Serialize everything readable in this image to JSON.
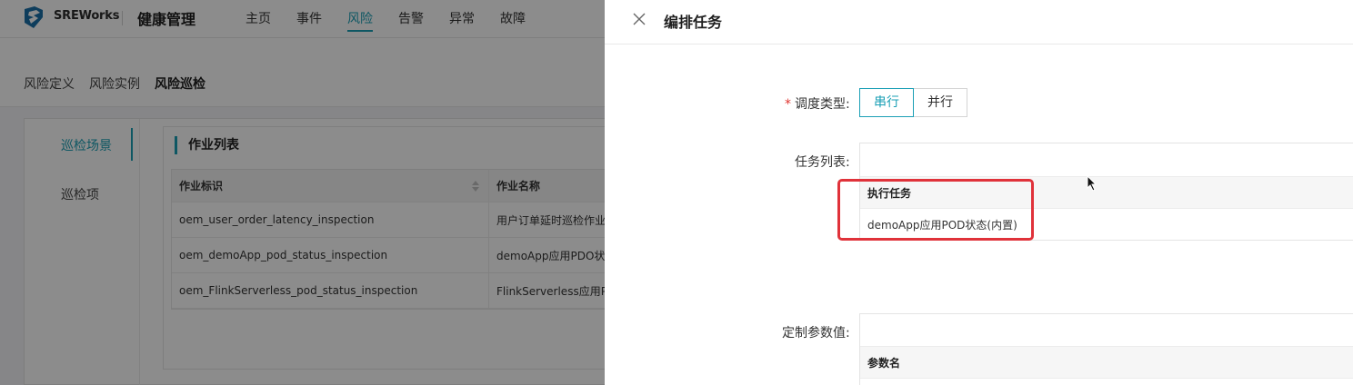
{
  "app": {
    "brand": "SREWorks",
    "title": "健康管理",
    "nav": [
      "主页",
      "事件",
      "风险",
      "告警",
      "异常",
      "故障"
    ],
    "nav_active_index": 2,
    "subnav": [
      "风险定义",
      "风险实例",
      "风险巡检"
    ],
    "subnav_active_index": 2,
    "left_menu": [
      "巡检场景",
      "巡检项"
    ],
    "panel_title": "作业列表",
    "table": {
      "columns": [
        "作业标识",
        "作业名称"
      ],
      "rows": [
        [
          "oem_user_order_latency_inspection",
          "用户订单延时巡检作业"
        ],
        [
          "oem_demoApp_pod_status_inspection",
          "demoApp应用PDO状态"
        ],
        [
          "oem_FlinkServerless_pod_status_inspection",
          "FlinkServerless应用PI"
        ]
      ]
    }
  },
  "drawer": {
    "title": "编排任务",
    "schedule_label": "调度类型:",
    "schedule_options": [
      "串行",
      "并行"
    ],
    "schedule_selected": "串行",
    "task_list_label": "任务列表:",
    "task_table_header": "执行任务",
    "task_rows": [
      "demoApp应用POD状态(内置)"
    ],
    "param_label": "定制参数值:",
    "param_table_header": "参数名"
  },
  "colors": {
    "accent": "#1a9fb5",
    "highlight": "#e0323a",
    "required": "#e0342f"
  }
}
